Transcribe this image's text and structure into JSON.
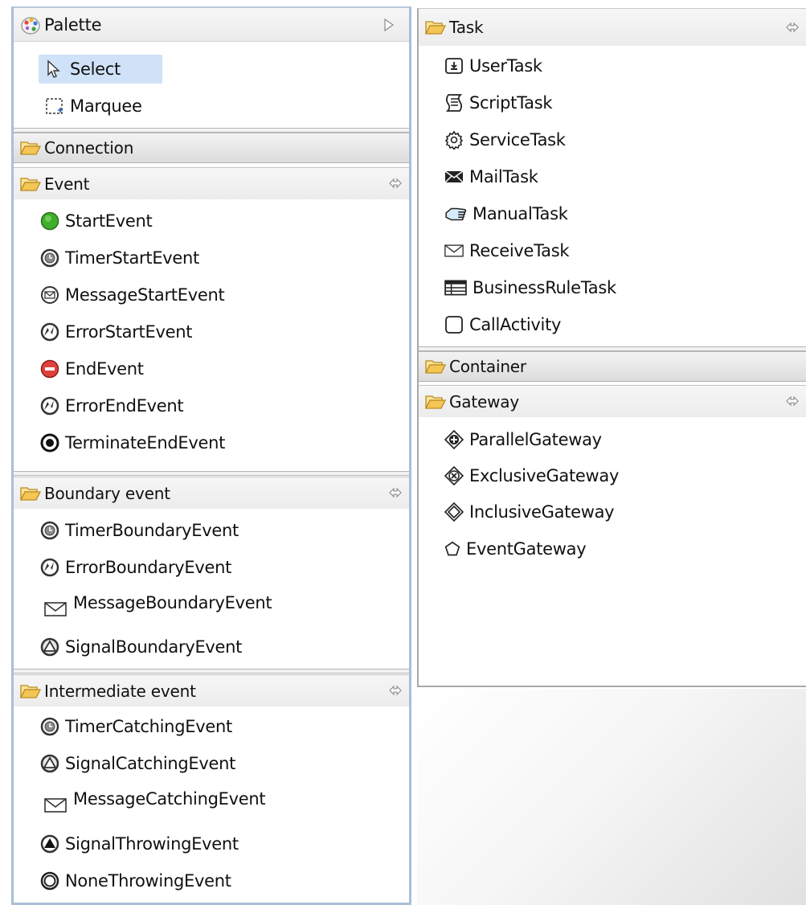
{
  "palette": {
    "title": "Palette",
    "tools": {
      "select": "Select",
      "marquee": "Marquee"
    }
  },
  "left_drawers": {
    "connection": {
      "label": "Connection"
    },
    "event": {
      "label": "Event",
      "items": [
        "StartEvent",
        "TimerStartEvent",
        "MessageStartEvent",
        "ErrorStartEvent",
        "EndEvent",
        "ErrorEndEvent",
        "TerminateEndEvent"
      ]
    },
    "boundary_event": {
      "label": "Boundary event",
      "items": [
        "TimerBoundaryEvent",
        "ErrorBoundaryEvent",
        "MessageBoundaryEvent",
        "SignalBoundaryEvent"
      ]
    },
    "intermediate_event": {
      "label": "Intermediate event",
      "items": [
        "TimerCatchingEvent",
        "SignalCatchingEvent",
        "MessageCatchingEvent",
        "SignalThrowingEvent",
        "NoneThrowingEvent"
      ]
    }
  },
  "right_drawers": {
    "task": {
      "label": "Task",
      "items": [
        "UserTask",
        "ScriptTask",
        "ServiceTask",
        "MailTask",
        "ManualTask",
        "ReceiveTask",
        "BusinessRuleTask",
        "CallActivity"
      ]
    },
    "container": {
      "label": "Container"
    },
    "gateway": {
      "label": "Gateway",
      "items": [
        "ParallelGateway",
        "ExclusiveGateway",
        "InclusiveGateway",
        "EventGateway"
      ]
    }
  },
  "colors": {
    "panel_border": "#a9bfd6",
    "select_highlight": "#cfe2f8",
    "start_event_green": "#3fae2a",
    "end_event_red": "#e0413a",
    "folder_yellow": "#f0c24a"
  },
  "icons": {
    "palette": "palette-icon",
    "collapse": "triangle-right-icon",
    "pin": "pin-arrows-icon",
    "folder": "folder-open-icon"
  }
}
